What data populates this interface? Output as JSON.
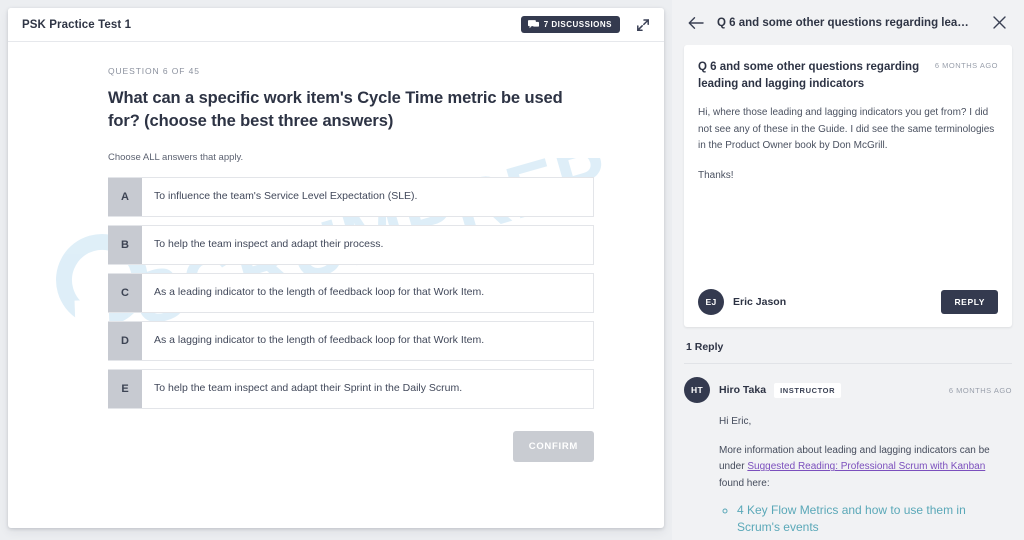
{
  "quiz": {
    "title": "PSK Practice Test 1",
    "discussions_badge": "7 DISCUSSIONS",
    "discussions_icon": "chat-icon",
    "expand_icon": "expand-icon",
    "question_number": "QUESTION 6 OF 45",
    "question_text": "What can a specific work item's Cycle Time metric be used for? (choose the best three answers)",
    "instruction": "Choose ALL answers that apply.",
    "options": [
      {
        "letter": "A",
        "text": "To influence the team's Service Level Expectation (SLE)."
      },
      {
        "letter": "B",
        "text": "To help the team inspect and adapt their process."
      },
      {
        "letter": "C",
        "text": "As a leading indicator to the length of feedback loop for that Work Item."
      },
      {
        "letter": "D",
        "text": "As a lagging indicator to the length of feedback loop for that Work Item."
      },
      {
        "letter": "E",
        "text": "To help the team inspect and adapt their Sprint in the Daily Scrum."
      }
    ],
    "confirm_label": "CONFIRM",
    "watermark": "SCRUMPREP"
  },
  "discussion": {
    "back_icon": "back-arrow-icon",
    "close_icon": "close-icon",
    "header_title": "Q 6 and some other questions regarding lea…",
    "thread": {
      "title": "Q 6 and some other questions regarding leading and lagging indicators",
      "time": "6 MONTHS AGO",
      "paragraph_1": "Hi, where those leading and lagging indicators you get from? I did not see any of these in the Guide. I did see the same terminologies in the Product Owner book by Don McGrill.",
      "paragraph_2": "Thanks!",
      "author_initials": "EJ",
      "author_name": "Eric Jason",
      "reply_label": "REPLY"
    },
    "reply_count": "1 Reply",
    "replies": [
      {
        "initials": "HT",
        "name": "Hiro Taka",
        "badge": "INSTRUCTOR",
        "time": "6 MONTHS AGO",
        "greeting": "Hi Eric,",
        "body_before_link": "More information about leading and lagging indicators can be under ",
        "link_text": "Suggested Reading: Professional Scrum with Kanban",
        "body_after_link": " found here:",
        "list_items": [
          "4 Key Flow Metrics and how to use them in Scrum's events"
        ]
      }
    ]
  },
  "colors": {
    "dark_navy": "#343a4f",
    "page_bg": "#eceef1",
    "panel_bg": "#f1f2f4",
    "letter_box": "#c7cad1",
    "confirm_disabled": "#c9ccd2",
    "link_purple": "#7b4fbd",
    "list_link_teal": "#5aa8b8",
    "watermark_blue": "#d9ecf7"
  }
}
